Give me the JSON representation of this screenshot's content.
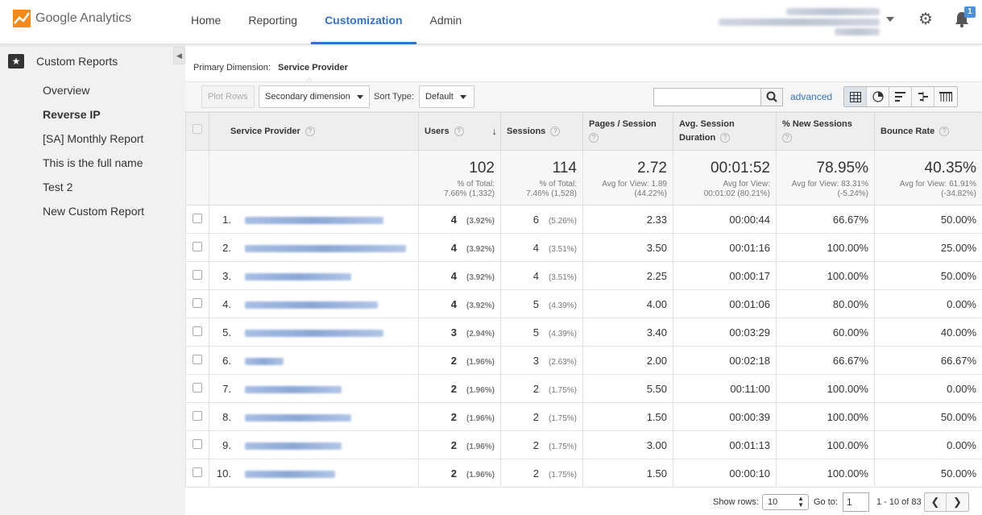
{
  "app": {
    "name": "Google Analytics"
  },
  "nav": {
    "items": [
      "Home",
      "Reporting",
      "Customization",
      "Admin"
    ],
    "active": "Customization"
  },
  "header": {
    "notification_count": "1"
  },
  "sidebar": {
    "header": "Custom Reports",
    "items": [
      "Overview",
      "Reverse IP",
      "[SA] Monthly Report",
      "This is the full name",
      "Test 2",
      "New Custom Report"
    ],
    "selected": "Reverse IP"
  },
  "report": {
    "primary_dimension_label": "Primary Dimension:",
    "primary_dimension_value": "Service Provider"
  },
  "toolbar": {
    "plot_rows": "Plot Rows",
    "secondary_dimension": "Secondary dimension",
    "sort_type_label": "Sort Type:",
    "sort_type_value": "Default",
    "advanced": "advanced"
  },
  "table": {
    "headers": {
      "service_provider": "Service Provider",
      "users": "Users",
      "sessions": "Sessions",
      "pages_per_session": "Pages / Session",
      "avg_session_duration": "Avg. Session Duration",
      "new_sessions": "% New Sessions",
      "bounce_rate": "Bounce Rate"
    },
    "totals": {
      "users": {
        "value": "102",
        "sub1": "% of Total:",
        "sub2": "7.66% (1,332)"
      },
      "sessions": {
        "value": "114",
        "sub1": "% of Total:",
        "sub2": "7.46% (1,528)"
      },
      "pages_per_session": {
        "value": "2.72",
        "sub1": "Avg for View: 1.89",
        "sub2": "(44.22%)"
      },
      "avg_session_duration": {
        "value": "00:01:52",
        "sub1": "Avg for View:",
        "sub2": "00:01:02 (80.21%)"
      },
      "new_sessions": {
        "value": "78.95%",
        "sub1": "Avg for View: 83.31%",
        "sub2": "(-5.24%)"
      },
      "bounce_rate": {
        "value": "40.35%",
        "sub1": "Avg for View: 61.91%",
        "sub2": "(-34.82%)"
      }
    },
    "rows": [
      {
        "n": "1.",
        "users": "4",
        "users_pct": "(3.92%)",
        "sessions": "6",
        "sessions_pct": "(5.26%)",
        "pps": "2.33",
        "dur": "00:00:44",
        "new": "66.67%",
        "bounce": "50.00%"
      },
      {
        "n": "2.",
        "users": "4",
        "users_pct": "(3.92%)",
        "sessions": "4",
        "sessions_pct": "(3.51%)",
        "pps": "3.50",
        "dur": "00:01:16",
        "new": "100.00%",
        "bounce": "25.00%"
      },
      {
        "n": "3.",
        "users": "4",
        "users_pct": "(3.92%)",
        "sessions": "4",
        "sessions_pct": "(3.51%)",
        "pps": "2.25",
        "dur": "00:00:17",
        "new": "100.00%",
        "bounce": "50.00%"
      },
      {
        "n": "4.",
        "users": "4",
        "users_pct": "(3.92%)",
        "sessions": "5",
        "sessions_pct": "(4.39%)",
        "pps": "4.00",
        "dur": "00:01:06",
        "new": "80.00%",
        "bounce": "0.00%"
      },
      {
        "n": "5.",
        "users": "3",
        "users_pct": "(2.94%)",
        "sessions": "5",
        "sessions_pct": "(4.39%)",
        "pps": "3.40",
        "dur": "00:03:29",
        "new": "60.00%",
        "bounce": "40.00%"
      },
      {
        "n": "6.",
        "users": "2",
        "users_pct": "(1.96%)",
        "sessions": "3",
        "sessions_pct": "(2.63%)",
        "pps": "2.00",
        "dur": "00:02:18",
        "new": "66.67%",
        "bounce": "66.67%"
      },
      {
        "n": "7.",
        "users": "2",
        "users_pct": "(1.96%)",
        "sessions": "2",
        "sessions_pct": "(1.75%)",
        "pps": "5.50",
        "dur": "00:11:00",
        "new": "100.00%",
        "bounce": "0.00%"
      },
      {
        "n": "8.",
        "users": "2",
        "users_pct": "(1.96%)",
        "sessions": "2",
        "sessions_pct": "(1.75%)",
        "pps": "1.50",
        "dur": "00:00:39",
        "new": "100.00%",
        "bounce": "50.00%"
      },
      {
        "n": "9.",
        "users": "2",
        "users_pct": "(1.96%)",
        "sessions": "2",
        "sessions_pct": "(1.75%)",
        "pps": "3.00",
        "dur": "00:01:13",
        "new": "100.00%",
        "bounce": "0.00%"
      },
      {
        "n": "10.",
        "users": "2",
        "users_pct": "(1.96%)",
        "sessions": "2",
        "sessions_pct": "(1.75%)",
        "pps": "1.50",
        "dur": "00:00:10",
        "new": "100.00%",
        "bounce": "50.00%"
      }
    ]
  },
  "footer": {
    "show_rows_label": "Show rows:",
    "show_rows_value": "10",
    "goto_label": "Go to:",
    "goto_value": "1",
    "range": "1 - 10 of 83"
  },
  "colors": {
    "accent": "#2f74d0",
    "sidebar_bg": "#f1f1f1",
    "header_bg": "#eeeeee"
  }
}
